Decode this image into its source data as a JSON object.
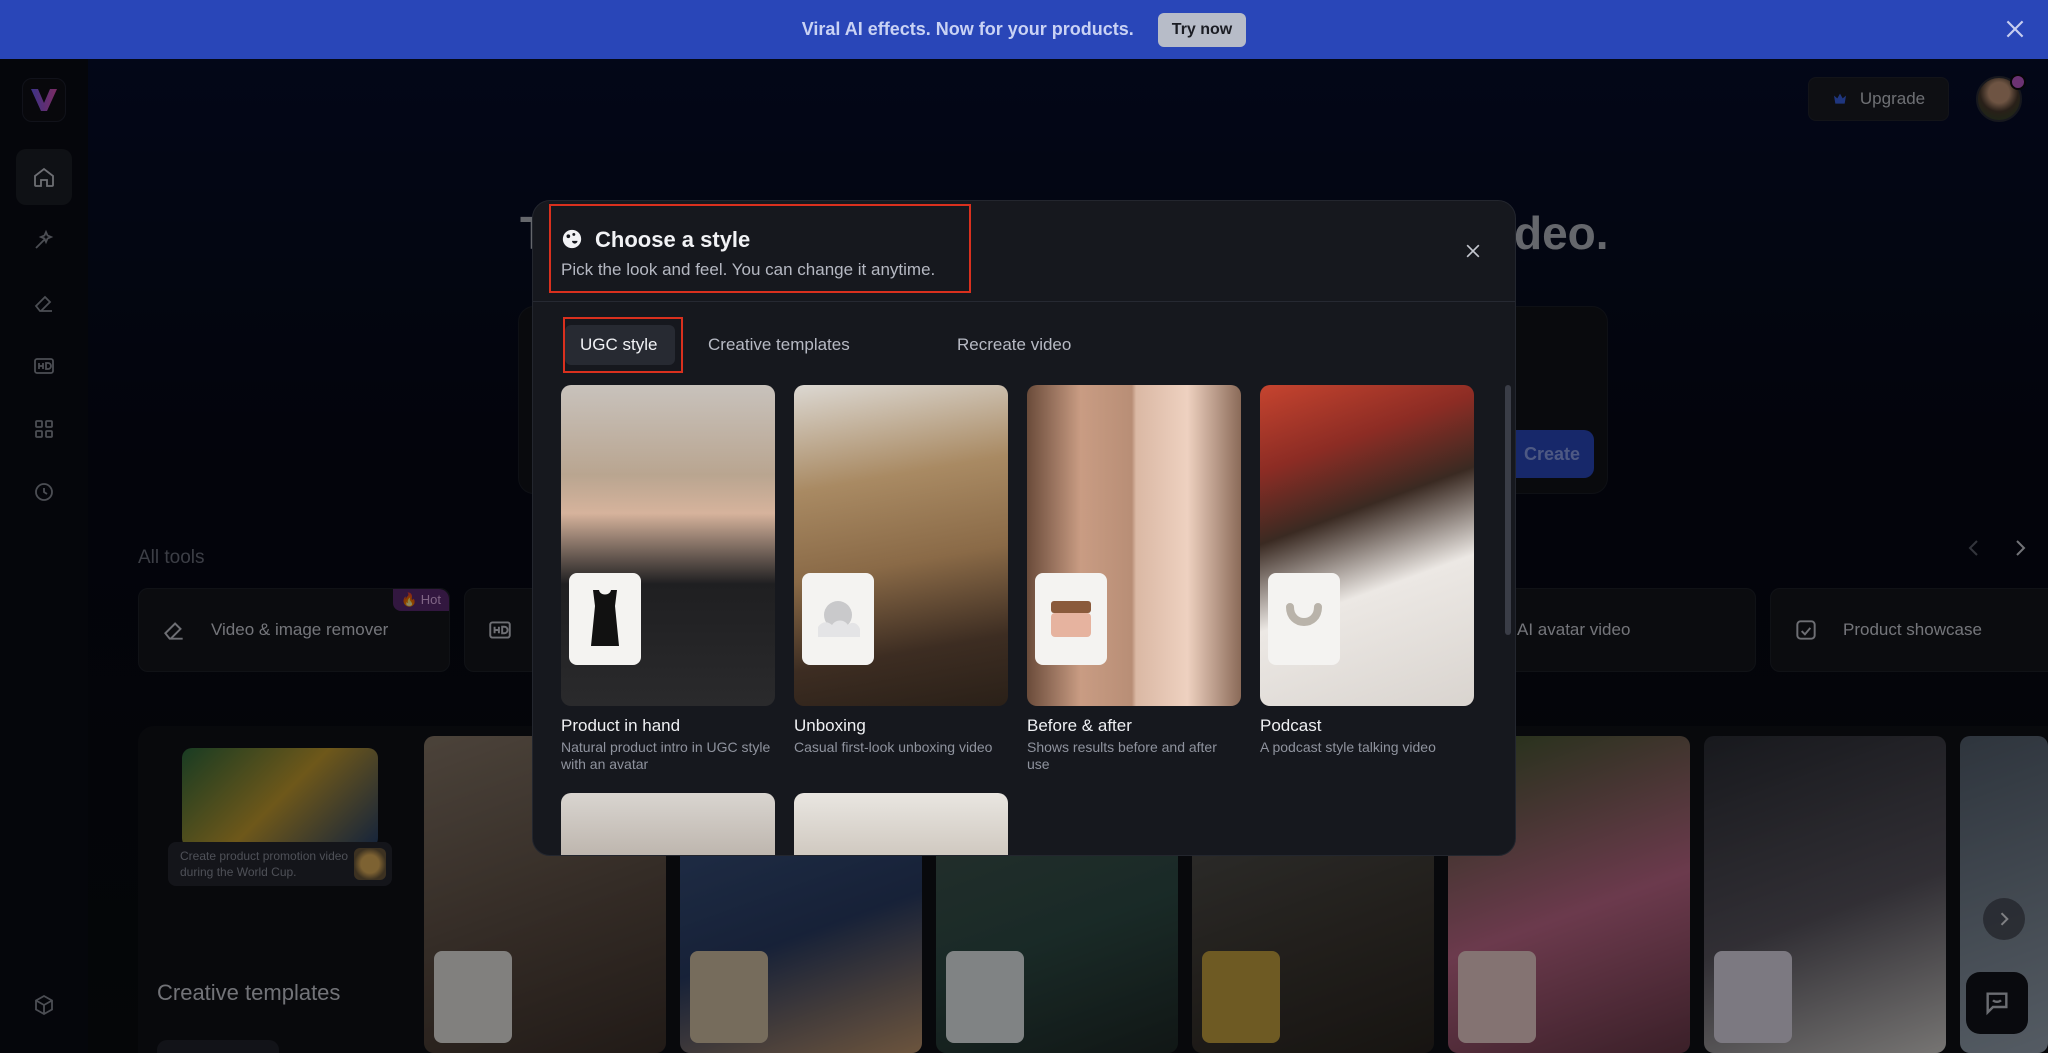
{
  "banner": {
    "text": "Viral AI effects. Now for your products.",
    "button": "Try now"
  },
  "header": {
    "upgrade": "Upgrade"
  },
  "background": {
    "headline_left": "T",
    "headline_right": "deo.",
    "create": "Create",
    "all_tools": "All tools",
    "tools": [
      {
        "label": "Video & image remover",
        "badge": "🔥 Hot"
      },
      {
        "label": ""
      },
      {
        "label": "AI avatar video"
      },
      {
        "label": "Product showcase"
      }
    ],
    "creative_title": "Creative templates",
    "hero_note": "Create product promotion video during the World Cup."
  },
  "modal": {
    "title": "Choose a style",
    "subtitle": "Pick the look and feel. You can change it anytime.",
    "tabs": [
      "UGC style",
      "Creative templates",
      "Recreate video"
    ],
    "active_tab": "UGC style",
    "styles": [
      {
        "name": "Product in hand",
        "desc": "Natural product intro in UGC style with an avatar"
      },
      {
        "name": "Unboxing",
        "desc": "Casual first-look unboxing video"
      },
      {
        "name": "Before & after",
        "desc": "Shows results before and after use"
      },
      {
        "name": "Podcast",
        "desc": "A podcast style talking video"
      }
    ]
  },
  "colors": {
    "banner": "#2946b8",
    "accent": "#2a49c2",
    "highlight": "#d9301e"
  }
}
